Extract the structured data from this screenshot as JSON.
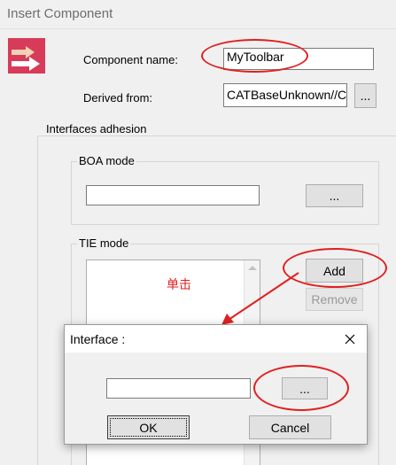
{
  "window": {
    "title": "Insert Component"
  },
  "form": {
    "component_name_label": "Component name:",
    "component_name_value": "MyToolbar",
    "derived_from_label": "Derived from:",
    "derived_from_value": "CATBaseUnknown//C",
    "browse_label": "..."
  },
  "interfaces": {
    "group_label": "Interfaces adhesion",
    "boa": {
      "label": "BOA mode",
      "value": "",
      "browse_label": "..."
    },
    "tie": {
      "label": "TIE mode",
      "add_label": "Add",
      "remove_label": "Remove"
    }
  },
  "annotation": {
    "click_text": "单击",
    "color": "#e02020"
  },
  "dialog": {
    "title": "Interface :",
    "value": "",
    "browse_label": "...",
    "ok_label": "OK",
    "cancel_label": "Cancel"
  }
}
